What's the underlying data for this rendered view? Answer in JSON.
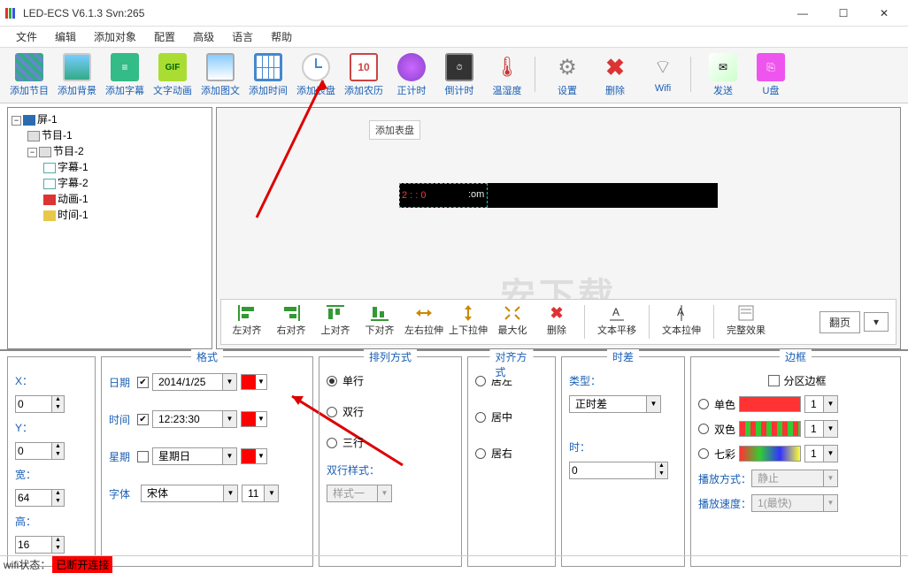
{
  "app": {
    "title": "LED-ECS V6.1.3 Svn:265"
  },
  "menu": {
    "file": "文件",
    "edit": "编辑",
    "addobj": "添加对象",
    "config": "配置",
    "advanced": "高级",
    "language": "语言",
    "help": "帮助"
  },
  "toolbar": {
    "add_program": "添加节目",
    "add_bg": "添加背景",
    "add_subtitle": "添加字幕",
    "text_anim": "文字动画",
    "add_imgtext": "添加图文",
    "add_time": "添加时间",
    "add_dial": "添加表盘",
    "add_lunar": "添加农历",
    "count_up": "正计时",
    "count_down": "倒计时",
    "temp_hum": "温湿度",
    "settings": "设置",
    "delete": "删除",
    "wifi": "Wifi",
    "send": "发送",
    "udisk": "U盘",
    "tooltip_dial": "添加表盘"
  },
  "tree": {
    "screen": "屏-1",
    "prog1": "节目-1",
    "prog2": "节目-2",
    "sub1": "字幕-1",
    "sub2": "字幕-2",
    "anim1": "动画-1",
    "time1": "时间-1"
  },
  "preview": {
    "time_red": "2 :    : 0",
    "time_suffix": ":om"
  },
  "preview_tb": {
    "align_left": "左对齐",
    "align_right": "右对齐",
    "align_top": "上对齐",
    "align_bottom": "下对齐",
    "stretch_h": "左右拉伸",
    "stretch_v": "上下拉伸",
    "maximize": "最大化",
    "delete": "删除",
    "text_shift": "文本平移",
    "text_stretch": "文本拉伸",
    "full_effect": "完整效果",
    "page": "翻页"
  },
  "pos": {
    "x_label": "X：",
    "x": "0",
    "y_label": "Y：",
    "y": "0",
    "w_label": "宽：",
    "w": "64",
    "h_label": "高：",
    "h": "16"
  },
  "fmt": {
    "legend": "格式",
    "date_label": "日期",
    "date": "2014/1/25",
    "time_label": "时间",
    "time": "12:23:30",
    "week_label": "星期",
    "week": "星期日",
    "font_label": "字体",
    "font": "宋体",
    "font_size": "11"
  },
  "arrange": {
    "legend": "排列方式",
    "single": "单行",
    "double": "双行",
    "triple": "三行",
    "dbl_style_label": "双行样式：",
    "dbl_style": "样式一"
  },
  "align": {
    "legend": "对齐方式",
    "left": "居左",
    "center": "居中",
    "right": "居右"
  },
  "tz": {
    "legend": "时差",
    "type_label": "类型：",
    "type": "正时差",
    "hour_label": "时：",
    "hour": "0"
  },
  "border": {
    "legend": "边框",
    "partition": "分区边框",
    "mono": "单色",
    "duo": "双色",
    "rainbow": "七彩",
    "play_label": "播放方式：",
    "play": "静止",
    "speed_label": "播放速度：",
    "speed": "1(最快)",
    "val_mono": "1",
    "val_duo": "1",
    "val_rainbow": "1"
  },
  "status": {
    "wifi_label": "wifi状态：",
    "wifi_value": "已断开连接"
  },
  "watermark": "安下载"
}
